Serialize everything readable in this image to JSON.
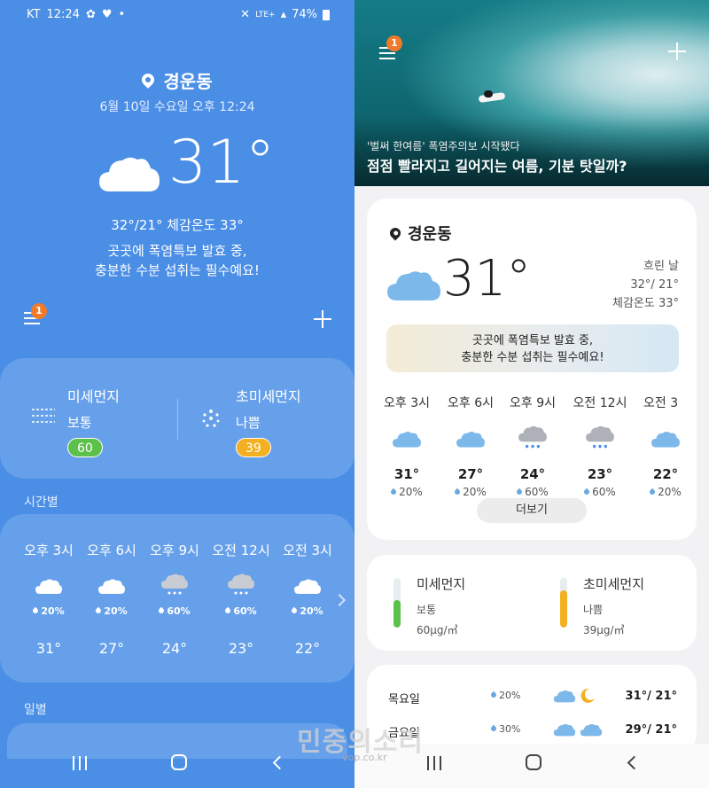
{
  "left": {
    "status_bar": {
      "carrier": "KT",
      "time": "12:24",
      "battery": "74%",
      "network": "LTE+"
    },
    "location": "경운동",
    "datetime": "6월 10일 수요일 오후 12:24",
    "temperature": "31°",
    "minmax_feels": "32°/21° 체감온도 33°",
    "message_line1": "곳곳에 폭염특보 발효 중,",
    "message_line2": "충분한 수분 섭취는 필수예요!",
    "menu_badge": "1",
    "dust": {
      "pm10": {
        "label": "미세먼지",
        "status": "보통",
        "value": "60"
      },
      "pm25": {
        "label": "초미세먼지",
        "status": "나쁨",
        "value": "39"
      }
    },
    "hourly_title": "시간별",
    "hourly": [
      {
        "time": "오후 3시",
        "icon": "cloud-icon",
        "precip": "20%",
        "temp": "31°"
      },
      {
        "time": "오후 6시",
        "icon": "cloud-icon",
        "precip": "20%",
        "temp": "27°"
      },
      {
        "time": "오후 9시",
        "icon": "rain-cloud-icon",
        "precip": "60%",
        "temp": "24°"
      },
      {
        "time": "오전 12시",
        "icon": "rain-cloud-icon",
        "precip": "60%",
        "temp": "23°"
      },
      {
        "time": "오전 3시",
        "icon": "cloud-icon",
        "precip": "20%",
        "temp": "22°"
      }
    ],
    "daily_title": "일별"
  },
  "right": {
    "menu_badge": "1",
    "news": {
      "subtitle": "'벌써 한여름' 폭염주의보 시작됐다",
      "title": "점점 빨라지고 길어지는 여름, 기분 탓일까?"
    },
    "location": "경운동",
    "temperature": "31°",
    "condition": "흐린 날",
    "minmax": "32°/ 21°",
    "feels_like": "체감온도 33°",
    "message_line1": "곳곳에 폭염특보 발효 중,",
    "message_line2": "충분한 수분 섭취는 필수예요!",
    "hourly": [
      {
        "time": "오후 3시",
        "icon": "cloud-icon",
        "temp": "31°",
        "precip": "20%"
      },
      {
        "time": "오후 6시",
        "icon": "cloud-icon",
        "temp": "27°",
        "precip": "20%"
      },
      {
        "time": "오후 9시",
        "icon": "rain-cloud-icon",
        "temp": "24°",
        "precip": "60%"
      },
      {
        "time": "오전 12시",
        "icon": "rain-cloud-icon",
        "temp": "23°",
        "precip": "60%"
      },
      {
        "time": "오전 3",
        "icon": "cloud-icon",
        "temp": "22°",
        "precip": "20%"
      }
    ],
    "more_button": "더보기",
    "dust": {
      "pm10": {
        "label": "미세먼지",
        "status": "보통",
        "value": "60µg/㎥",
        "level": 0.55,
        "color": "#5cc14a"
      },
      "pm25": {
        "label": "초미세먼지",
        "status": "나쁨",
        "value": "39µg/㎥",
        "level": 0.75,
        "color": "#f3b020"
      }
    },
    "daily": [
      {
        "day": "목요일",
        "precip": "20%",
        "icons": [
          "cloud-icon",
          "moon-icon"
        ],
        "temps": "31°/ 21°"
      },
      {
        "day": "금요일",
        "precip": "30%",
        "icons": [
          "cloud-icon",
          "cloud-icon"
        ],
        "temps": "29°/ 21°"
      }
    ],
    "watermark": "민중의소리",
    "watermark_url": "vop.co.kr"
  },
  "colors": {
    "left_bg": "#4a8ee6",
    "badge": "#f07a2a",
    "good": "#5cc14a",
    "bad": "#f3b020",
    "cloud_blue": "#7cb8ea"
  }
}
